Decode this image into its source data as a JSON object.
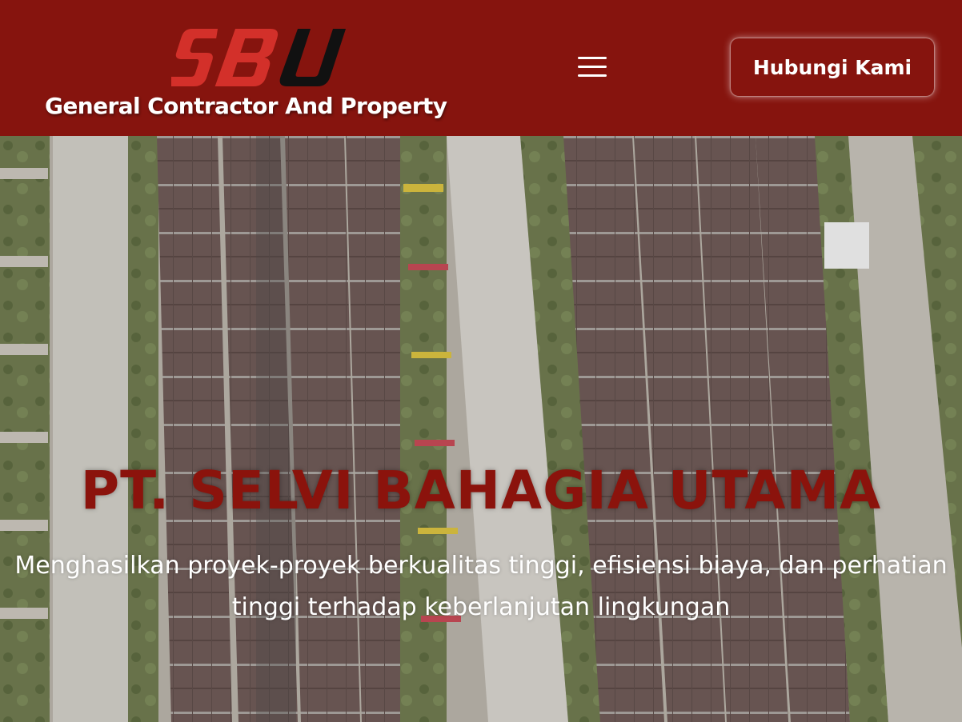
{
  "header": {
    "logo_text": "SBU",
    "tagline": "General Contractor And Property",
    "contact_label": "Hubungi Kami",
    "menu_icon": "hamburger-menu-icon"
  },
  "hero": {
    "title": "PT. SELVI BAHAGIA UTAMA",
    "subtitle": "Menghasilkan proyek-proyek berkualitas tinggi, efisiensi biaya, dan perhatian tinggi terhadap keberlanjutan lingkungan"
  },
  "colors": {
    "brand_red": "#86140e",
    "logo_red": "#d3302a",
    "logo_black": "#111111",
    "title_red": "#8b130c"
  }
}
